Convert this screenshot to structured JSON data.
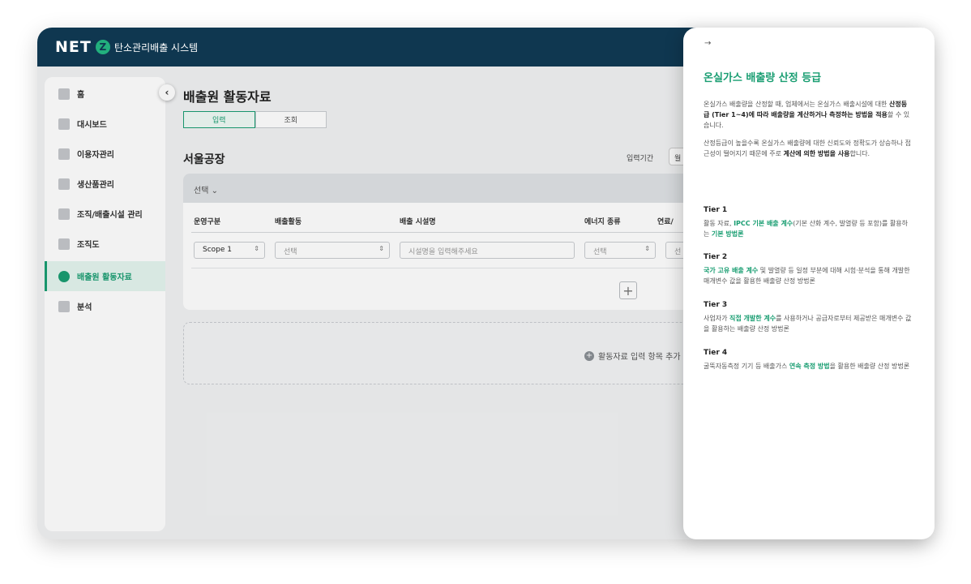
{
  "header": {
    "logo": "NET",
    "logo_mark": "Z",
    "app_title": "탄소관리배출 시스템"
  },
  "sidebar": {
    "collapse_icon": "‹",
    "items": [
      {
        "label": "홈",
        "icon": "home-icon"
      },
      {
        "label": "대시보드",
        "icon": "dashboard-icon"
      },
      {
        "label": "이용자관리",
        "icon": "users-icon"
      },
      {
        "label": "생산품관리",
        "icon": "box-icon"
      },
      {
        "label": "조직/배출시설 관리",
        "icon": "org-icon"
      },
      {
        "label": "조직도",
        "icon": "chart-icon"
      },
      {
        "label": "배출원 활동자료",
        "icon": "leaf-icon",
        "active": true
      },
      {
        "label": "분석",
        "icon": "analysis-icon"
      }
    ]
  },
  "main": {
    "title": "배출원 활동자료",
    "tabs": [
      {
        "label": "입력"
      },
      {
        "label": "조회"
      }
    ],
    "plant": "서울공장",
    "period_label": "입력기간",
    "period_value": "월",
    "card": {
      "select_label": "선택 ⌄",
      "columns": [
        "운영구분",
        "배출활동",
        "배출 시설명",
        "에너지 종류",
        "연료/"
      ],
      "row": {
        "scope": "Scope 1",
        "activity": "선택",
        "facility_placeholder": "시설명을 입력해주세요",
        "energy": "선택",
        "fuel": "선"
      },
      "add_row": "+"
    },
    "add_section_label": "활동자료 입력 항목 추가"
  },
  "drawer": {
    "close_icon": "→",
    "title": "온실가스 배출량 산정 등급",
    "intro_1a": "온실가스 배출량을 산정할 때, 업체에서는 온실가스 배출시설에 대한 ",
    "intro_1b": "산정등급 (Tier 1~4)에 따라 배출량을 계산하거나 측정하는 방법을 적용",
    "intro_1c": "할 수 있습니다.",
    "intro_2a": "산정등급이 높을수록 온실가스 배출량에 대한 신뢰도와 정확도가 상승하나 접근성이 떨어지기 때문에 주로 ",
    "intro_2b": "계산에 의한 방법을 사용",
    "intro_2c": "합니다.",
    "tiers": [
      {
        "name": "Tier 1",
        "a": "활동 자료, ",
        "hl": "IPCC 기본 배출 계수",
        "b": "(기본 산화 계수, 발열량 등 포함)를 활용하는 ",
        "hl2": "기본 방법론",
        "c": ""
      },
      {
        "name": "Tier 2",
        "a": "",
        "hl": "국가 고유 배출 계수",
        "b": " 및 발열량 등 일정 부분에 대해 시험·분석을 통해 개발한 매개변수 값을 활용한 배출량 산정 방법론",
        "hl2": "",
        "c": ""
      },
      {
        "name": "Tier 3",
        "a": "사업자가 ",
        "hl": "직접 개발한 계수",
        "b": "를 사용하거나 공급자로부터 제공받은 매개변수 값을 활용하는 배출량 산정 방법론",
        "hl2": "",
        "c": ""
      },
      {
        "name": "Tier 4",
        "a": "굴뚝자동측정 기기 등 배출가스 ",
        "hl": "연속 측정 방법",
        "b": "을 활용한 배출량 산정 방법론",
        "hl2": "",
        "c": ""
      }
    ]
  }
}
